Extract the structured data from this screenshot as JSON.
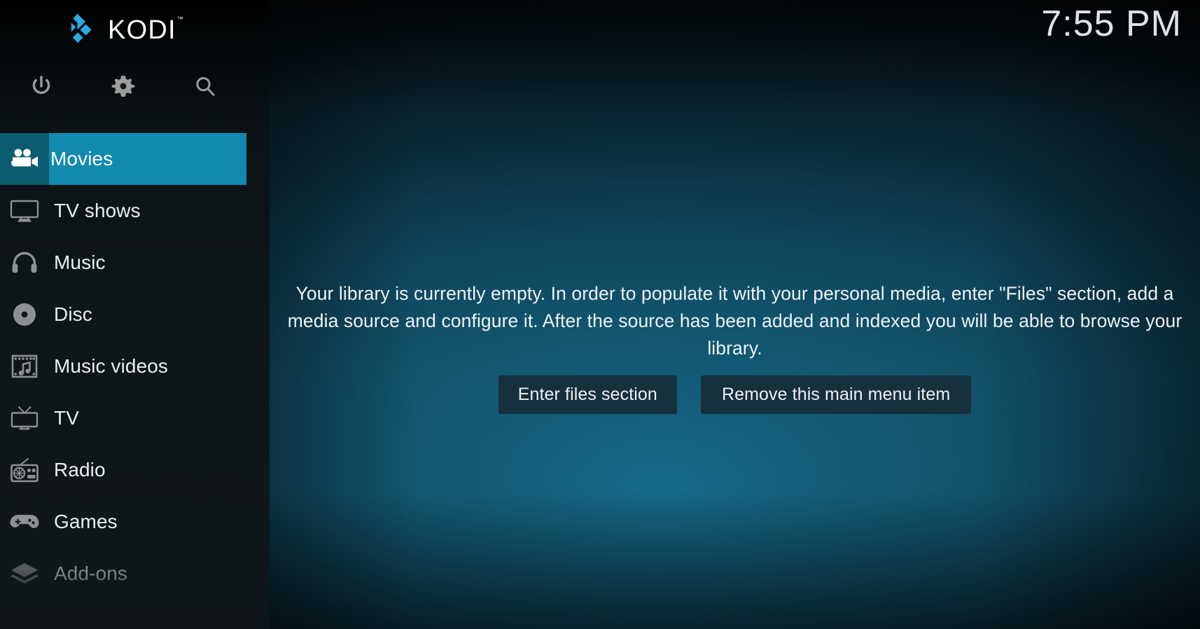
{
  "app": {
    "name": "KODI",
    "trademark": "™"
  },
  "clock": {
    "time": "7:55 PM"
  },
  "quick_actions": [
    {
      "name": "power-button",
      "icon": "power-icon",
      "label": "Power"
    },
    {
      "name": "settings-button",
      "icon": "gear-icon",
      "label": "Settings"
    },
    {
      "name": "search-button",
      "icon": "search-icon",
      "label": "Search"
    }
  ],
  "sidebar": {
    "items": [
      {
        "label": "Movies",
        "icon": "movie-camera-icon",
        "selected": true,
        "faded": false
      },
      {
        "label": "TV shows",
        "icon": "television-icon",
        "selected": false,
        "faded": false
      },
      {
        "label": "Music",
        "icon": "headphones-icon",
        "selected": false,
        "faded": false
      },
      {
        "label": "Disc",
        "icon": "disc-icon",
        "selected": false,
        "faded": false
      },
      {
        "label": "Music videos",
        "icon": "film-music-icon",
        "selected": false,
        "faded": false
      },
      {
        "label": "TV",
        "icon": "tv-antenna-icon",
        "selected": false,
        "faded": false
      },
      {
        "label": "Radio",
        "icon": "radio-icon",
        "selected": false,
        "faded": false
      },
      {
        "label": "Games",
        "icon": "gamepad-icon",
        "selected": false,
        "faded": false
      },
      {
        "label": "Add-ons",
        "icon": "layers-icon",
        "selected": false,
        "faded": true
      }
    ]
  },
  "main": {
    "empty_message": "Your library is currently empty. In order to populate it with your personal media, enter \"Files\" section, add a media source and configure it. After the source has been added and indexed you will be able to browse your library.",
    "buttons": [
      {
        "label": "Enter files section",
        "name": "enter-files-section-button"
      },
      {
        "label": "Remove this main menu item",
        "name": "remove-main-menu-item-button"
      }
    ]
  },
  "colors": {
    "accent": "#128aaf",
    "accent_dark": "#0b5b71",
    "logo_blue": "#29a9e1",
    "sidebar_bg": "#10171b",
    "button_bg": "#16303c",
    "text": "#eef3f5",
    "icon_gray": "#9a9a9a"
  }
}
